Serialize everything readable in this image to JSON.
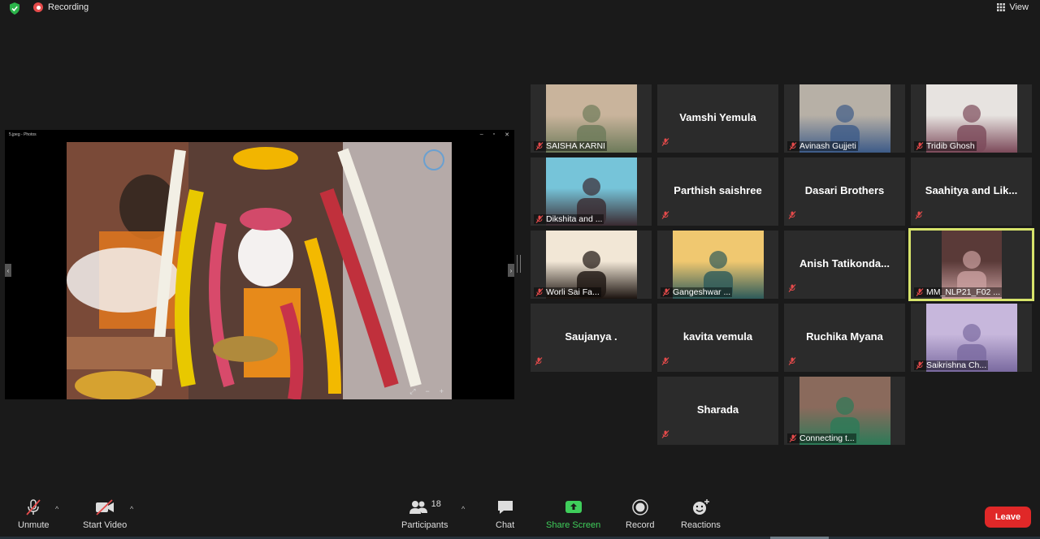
{
  "header": {
    "recording_label": "Recording",
    "view_label": "View"
  },
  "share": {
    "window_title": "5.jpeg - Photos"
  },
  "participants": [
    {
      "name": "SAISHA KARNI",
      "video": true
    },
    {
      "name": "Vamshi Yemula",
      "video": false
    },
    {
      "name": "Avinash Gujjeti",
      "video": true
    },
    {
      "name": "Tridib Ghosh",
      "video": true
    },
    {
      "name": "Dikshita and ...",
      "video": true
    },
    {
      "name": "Parthish saishree",
      "video": false
    },
    {
      "name": "Dasari Brothers",
      "video": false
    },
    {
      "name": "Saahitya  and  Lik...",
      "video": false
    },
    {
      "name": "Worli Sai Fa...",
      "video": true
    },
    {
      "name": "Gangeshwar ...",
      "video": true
    },
    {
      "name": "Anish  Tatikonda...",
      "video": false
    },
    {
      "name": "MM_NLP21_F02 ...",
      "video": true,
      "active": true
    },
    {
      "name": "Saujanya .",
      "video": false
    },
    {
      "name": "kavita vemula",
      "video": false
    },
    {
      "name": "Ruchika Myana",
      "video": false
    },
    {
      "name": "Saikrishna Ch...",
      "video": true
    },
    {
      "name": "Sharada",
      "video": false
    },
    {
      "name": "Connecting t...",
      "video": true
    }
  ],
  "toolbar": {
    "unmute": "Unmute",
    "start_video": "Start Video",
    "participants": "Participants",
    "participants_count": "18",
    "chat": "Chat",
    "share_screen": "Share Screen",
    "record": "Record",
    "reactions": "Reactions",
    "leave": "Leave"
  },
  "colors": {
    "share_green": "#3fce5b",
    "leave_red": "#e02828",
    "active_speaker": "#d7e36b",
    "muted_red": "#e54b4b"
  }
}
